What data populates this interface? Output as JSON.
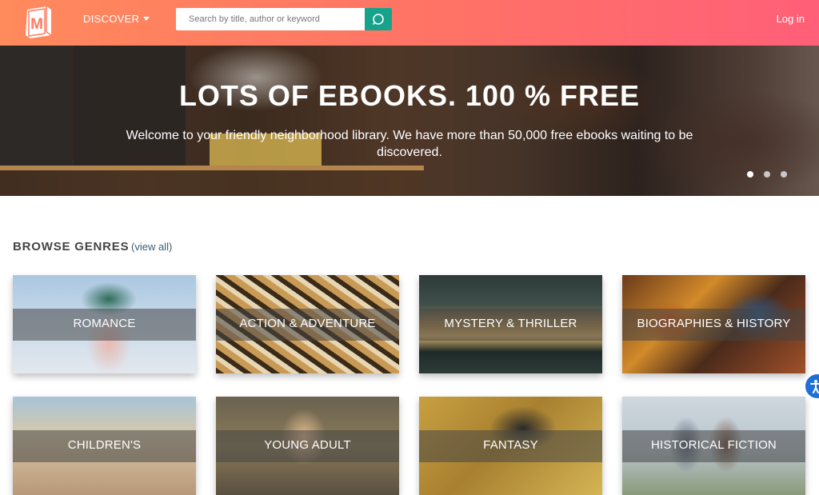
{
  "header": {
    "logo_letter": "M",
    "discover_label": "DISCOVER",
    "search_placeholder": "Search by title, author or keyword",
    "login_label": "Log in",
    "accent_color": "#17a38b"
  },
  "hero": {
    "title": "LOTS OF EBOOKS. 100 % FREE",
    "subtitle": "Welcome to your friendly neighborhood library. We have more than 50,000 free ebooks waiting to be discovered.",
    "slides": 3,
    "active_slide": 1
  },
  "browse": {
    "title": "BROWSE GENRES",
    "view_all": "(view all)",
    "genres": [
      {
        "label": "ROMANCE"
      },
      {
        "label": "ACTION & ADVENTURE"
      },
      {
        "label": "MYSTERY & THRILLER"
      },
      {
        "label": "BIOGRAPHIES & HISTORY"
      },
      {
        "label": "CHILDREN'S"
      },
      {
        "label": "YOUNG ADULT"
      },
      {
        "label": "FANTASY"
      },
      {
        "label": "HISTORICAL FICTION"
      }
    ]
  },
  "icons": {
    "logo": "book-logo-icon",
    "search": "search-icon",
    "discover_toggle": "caret-down-icon",
    "accessibility": "accessibility-icon"
  }
}
